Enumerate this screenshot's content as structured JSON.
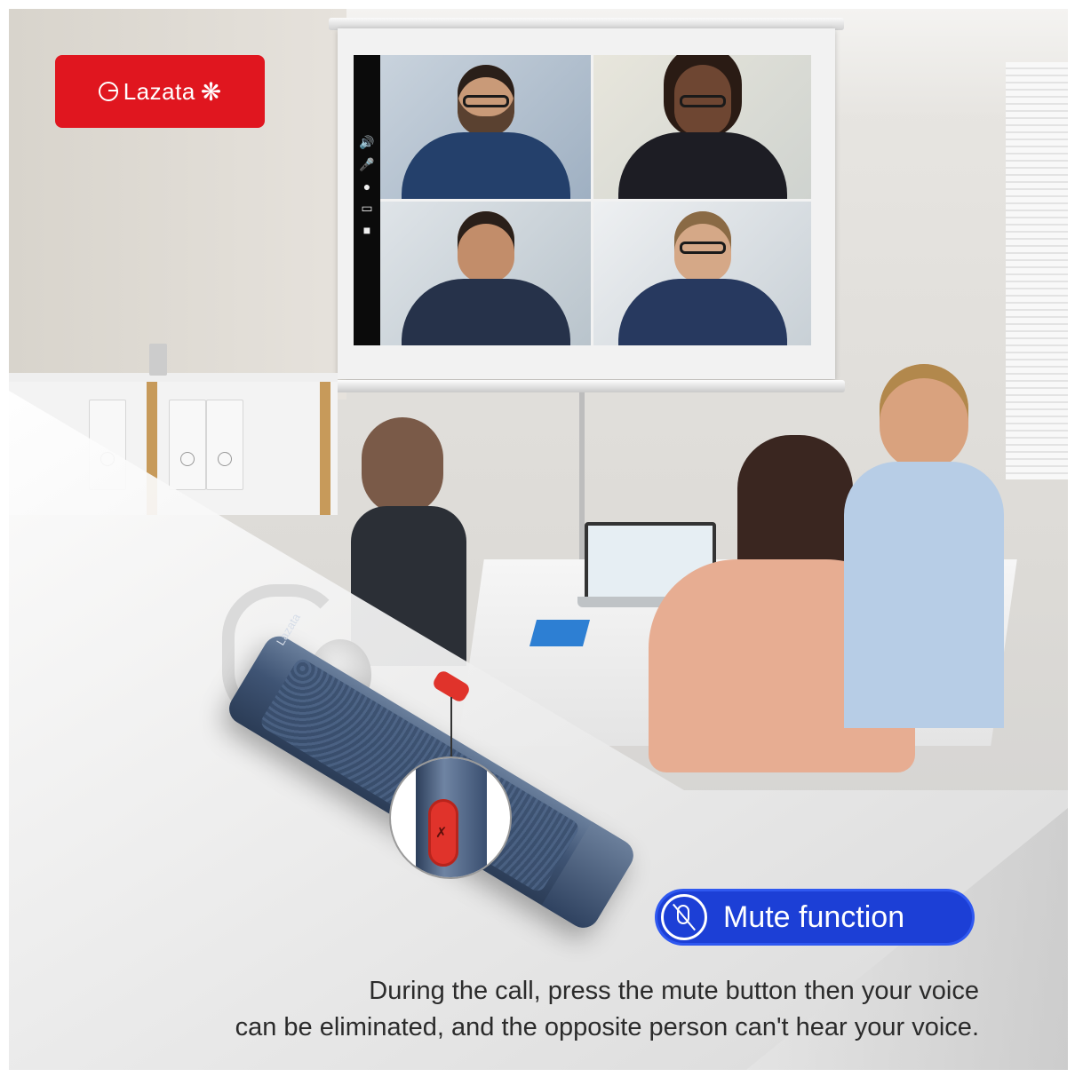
{
  "brand": {
    "name": "Lazata",
    "color": "#e0161f"
  },
  "feature": {
    "label": "Mute function",
    "color": "#1c3fd6",
    "icon": "mic-off-icon"
  },
  "description": {
    "line1": "During the call, press the mute button then your voice",
    "line2": "can be eliminated, and the opposite person can't hear your voice."
  },
  "device": {
    "logo_text": "Lazata",
    "mute_button_color": "#e0332b",
    "mute_button_icon": "mic-off-icon"
  },
  "video_call": {
    "toolbar_icons": [
      "speaker-icon",
      "mic-icon",
      "person-icon",
      "screen-icon",
      "camera-icon"
    ],
    "participants": 4
  }
}
